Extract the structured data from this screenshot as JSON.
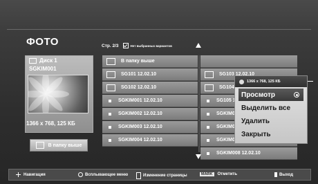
{
  "page": {
    "title": "ФОТО"
  },
  "left_panel": {
    "disk_label": "Диск 1",
    "folder_name": "SGKIM001",
    "thumb_info": "1366 x 768, 125 КБ",
    "up_folder_button": "В папку выше"
  },
  "list_header": {
    "page": "Стр. 2/3",
    "unselected_label": "Нет выбранных вариантов"
  },
  "items_col1": [
    {
      "type": "folder",
      "label": "В папку выше"
    },
    {
      "type": "folder",
      "label": "SG101 12.02.10"
    },
    {
      "type": "folder",
      "label": "SG102 12.02.10"
    },
    {
      "type": "file",
      "label": "SGKIM001 12.02.10"
    },
    {
      "type": "file",
      "label": "SGKIM002 12.02.10"
    },
    {
      "type": "file",
      "label": "SGKIM003 12.02.10"
    },
    {
      "type": "file",
      "label": "SGKIM004 12.02.10"
    }
  ],
  "items_col2": [
    {
      "type": "blank",
      "label": ""
    },
    {
      "type": "folder",
      "label": "SG103 12.02.10"
    },
    {
      "type": "folder",
      "label": "SG104 12.02.10"
    },
    {
      "type": "file",
      "label": "SG105 12.02.10"
    },
    {
      "type": "file",
      "label": "SGKIM005 12.02.10"
    },
    {
      "type": "file",
      "label": "SGKIM006 12.02.10"
    },
    {
      "type": "file",
      "label": "SGKIM007 12.02.10"
    },
    {
      "type": "file",
      "label": "SGKIM008 12.02.10"
    }
  ],
  "popup": {
    "info": "1366 x 768, 125 КБ",
    "items": [
      "Просмотр",
      "Выделить все",
      "Удалить",
      "Закрыть"
    ],
    "selected_index": 0
  },
  "bottom_bar": {
    "navigation": "Навигация",
    "popup_menu": "Всплывающее меню",
    "page_change": "Изменение страницы",
    "mark_key": "MARK",
    "mark": "Отметить",
    "exit": "Выход"
  }
}
